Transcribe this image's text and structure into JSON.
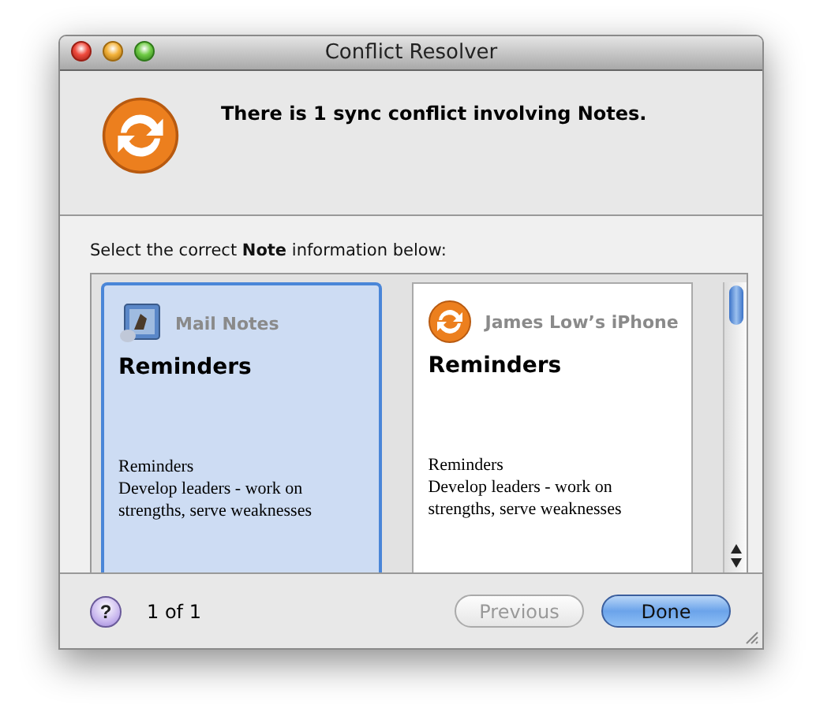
{
  "window": {
    "title": "Conflict Resolver"
  },
  "header": {
    "message": "There is 1 sync conflict involving Notes."
  },
  "prompt": "Select the correct **Note** information below:",
  "records": [
    {
      "source": "Mail Notes",
      "kind": "mail",
      "selected": true,
      "title": "Reminders",
      "body": [
        "Reminders",
        "Develop leaders - work on strengths, serve weaknesses"
      ]
    },
    {
      "source": "James Low’s iPhone",
      "kind": "sync",
      "selected": false,
      "title": "Reminders",
      "body": [
        "Reminders",
        "Develop leaders - work on strengths, serve weaknesses"
      ]
    }
  ],
  "footer": {
    "help": "?",
    "counter": "1 of 1",
    "buttons": [
      {
        "label": "Previous",
        "disabled": true,
        "default": false
      },
      {
        "label": "Done",
        "disabled": false,
        "default": true
      }
    ]
  }
}
